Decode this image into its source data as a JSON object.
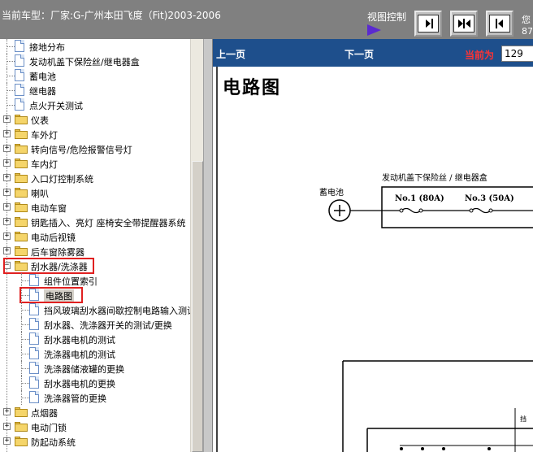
{
  "header": {
    "car_model": "当前车型：厂家:G-广州本田飞度（Fit)2003-2006",
    "view_control": "视图控制",
    "corner_text_1": "您",
    "corner_text_2": "87"
  },
  "toolbar": {
    "buttons": [
      {
        "name": "next-page-end-icon"
      },
      {
        "name": "two-page-icon"
      },
      {
        "name": "prev-page-start-icon"
      }
    ]
  },
  "tree": {
    "items": [
      {
        "label": "接地分布",
        "type": "doc",
        "level": 1
      },
      {
        "label": "发动机盖下保险丝/继电器盒",
        "type": "doc",
        "level": 1
      },
      {
        "label": "蓄电池",
        "type": "doc",
        "level": 1
      },
      {
        "label": "继电器",
        "type": "doc",
        "level": 1
      },
      {
        "label": "点火开关测试",
        "type": "doc",
        "level": 1
      },
      {
        "label": "仪表",
        "type": "folder",
        "level": 0,
        "expander": "+"
      },
      {
        "label": "车外灯",
        "type": "folder",
        "level": 0,
        "expander": "+"
      },
      {
        "label": "转向信号/危险报警信号灯",
        "type": "folder",
        "level": 0,
        "expander": "+"
      },
      {
        "label": "车内灯",
        "type": "folder",
        "level": 0,
        "expander": "+"
      },
      {
        "label": "入口灯控制系统",
        "type": "folder",
        "level": 0,
        "expander": "+"
      },
      {
        "label": "喇叭",
        "type": "folder",
        "level": 0,
        "expander": "+"
      },
      {
        "label": "电动车窗",
        "type": "folder",
        "level": 0,
        "expander": "+"
      },
      {
        "label": "钥匙插入、亮灯 座椅安全带提醒器系统",
        "type": "folder",
        "level": 0,
        "expander": "+"
      },
      {
        "label": "电动后视镜",
        "type": "folder",
        "level": 0,
        "expander": "+"
      },
      {
        "label": "后车窗除雾器",
        "type": "folder",
        "level": 0,
        "expander": "+"
      },
      {
        "label": "刮水器/洗涤器",
        "type": "folder",
        "level": 0,
        "expander": "-",
        "highlight": true
      },
      {
        "label": "组件位置索引",
        "type": "doc",
        "level": 1
      },
      {
        "label": "电路图",
        "type": "doc",
        "level": 1,
        "selected": true,
        "highlight": true
      },
      {
        "label": "挡风玻璃刮水器间歇控制电路输入测试",
        "type": "doc",
        "level": 1
      },
      {
        "label": "刮水器、洗涤器开关的测试/更换",
        "type": "doc",
        "level": 1
      },
      {
        "label": "刮水器电机的测试",
        "type": "doc",
        "level": 1
      },
      {
        "label": "洗涤器电机的测试",
        "type": "doc",
        "level": 1
      },
      {
        "label": "洗涤器储液罐的更换",
        "type": "doc",
        "level": 1
      },
      {
        "label": "刮水器电机的更换",
        "type": "doc",
        "level": 1
      },
      {
        "label": "洗涤器管的更换",
        "type": "doc",
        "level": 1
      },
      {
        "label": "点烟器",
        "type": "folder",
        "level": 0,
        "expander": "+"
      },
      {
        "label": "电动门锁",
        "type": "folder",
        "level": 0,
        "expander": "+"
      },
      {
        "label": "防起动系统",
        "type": "folder",
        "level": 0,
        "expander": "+"
      }
    ]
  },
  "viewer": {
    "prev_page": "上一页",
    "next_page": "下一页",
    "current_label": "当前为",
    "current_page": "129",
    "doc_title": "电路图",
    "fuse_box_title": "发动机盖下保险丝 / 继电器盒",
    "battery_label": "蓄电池",
    "fuse1": "No.1 (80A)",
    "fuse2": "No.3 (50A)",
    "small_text": "挡"
  },
  "colors": {
    "topbar": "#808080",
    "nav_bar": "#1e4f8c",
    "highlight_box": "#e02020",
    "current_label": "#ff3333"
  }
}
